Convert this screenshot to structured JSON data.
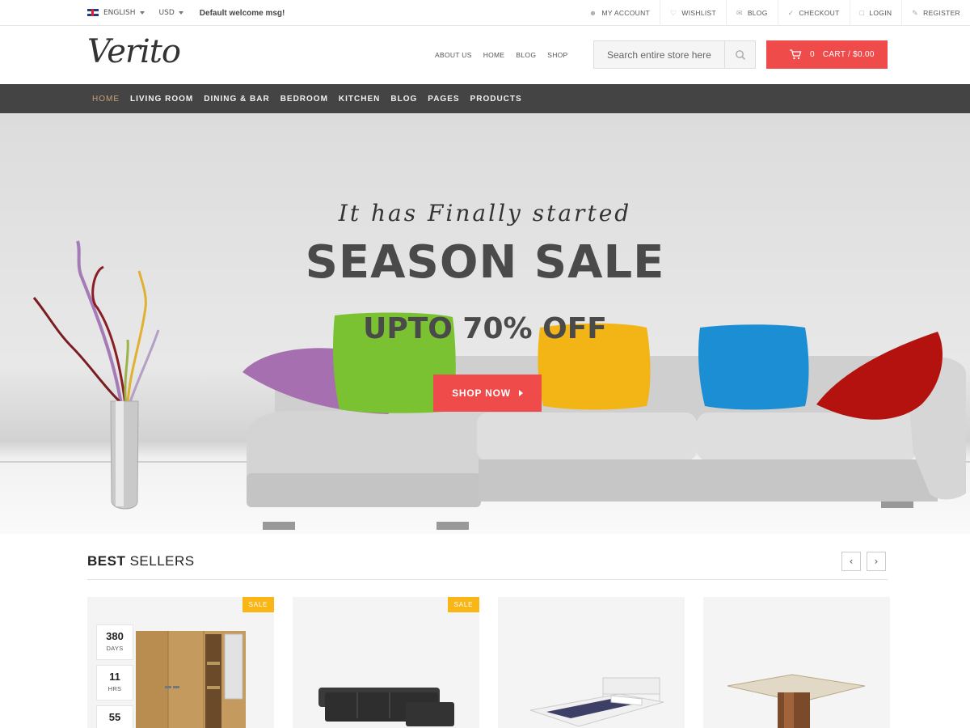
{
  "topbar": {
    "language": "ENGLISH",
    "currency": "USD",
    "welcome": "Default welcome msg!",
    "links": [
      {
        "label": "MY ACCOUNT",
        "icon": "user-icon"
      },
      {
        "label": "WISHLIST",
        "icon": "heart-icon"
      },
      {
        "label": "BLOG",
        "icon": "chat-icon"
      },
      {
        "label": "CHECKOUT",
        "icon": "check-icon"
      },
      {
        "label": "LOGIN",
        "icon": "lock-icon"
      },
      {
        "label": "REGISTER",
        "icon": "pencil-icon"
      }
    ]
  },
  "header": {
    "logo": "Verito",
    "links": [
      "ABOUT US",
      "HOME",
      "BLOG",
      "SHOP"
    ],
    "search_placeholder": "Search entire store here...",
    "cart_count": "0",
    "cart_label": "CART / $0.00"
  },
  "nav": {
    "items": [
      "HOME",
      "LIVING ROOM",
      "DINING & BAR",
      "BEDROOM",
      "KITCHEN",
      "BLOG",
      "PAGES",
      "PRODUCTS"
    ],
    "active": "HOME"
  },
  "hero": {
    "script": "It has Finally started",
    "title": "SEASON SALE",
    "subtitle": "UPTO 70% OFF",
    "button": "SHOP NOW"
  },
  "best_sellers": {
    "title_bold": "BEST",
    "title_rest": "SELLERS",
    "prev_icon": "chevron-left-icon",
    "next_icon": "chevron-right-icon",
    "sale_label": "SALE",
    "timer": [
      {
        "value": "380",
        "label": "DAYS"
      },
      {
        "value": "11",
        "label": "HRS"
      },
      {
        "value": "55",
        "label": ""
      }
    ]
  },
  "colors": {
    "accent": "#ef4b4b",
    "nav_bg": "#444444",
    "nav_active": "#c9a27a",
    "sale_badge": "#f9b616"
  }
}
